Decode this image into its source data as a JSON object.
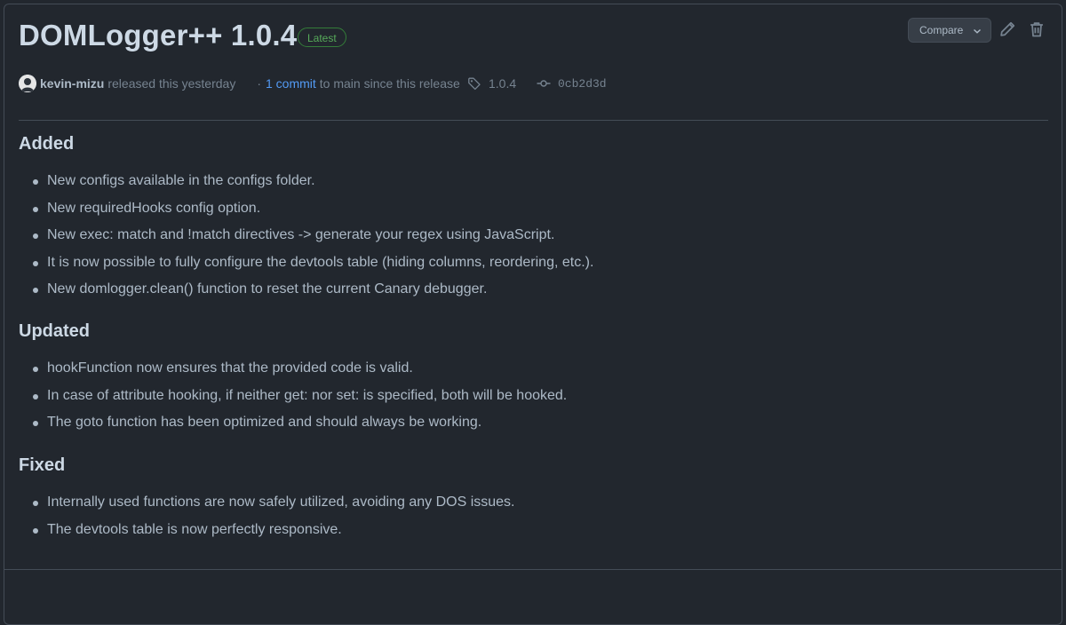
{
  "release": {
    "title": "DOMLogger++ 1.0.4",
    "badge": "Latest",
    "compare_label": "Compare",
    "author": "kevin-mizu",
    "released_text": "released this yesterday",
    "sep": "·",
    "commit_link": "1 commit",
    "commit_suffix": "to main since this release",
    "tag": "1.0.4",
    "sha": "0cb2d3d"
  },
  "icons": {
    "edit": "pencil-icon",
    "delete": "trash-icon",
    "tag": "tag-icon",
    "commit": "commit-icon",
    "caret": "chevron-down-icon"
  },
  "notes": {
    "added": {
      "heading": "Added",
      "items": [
        "New configs available in the configs folder.",
        "New requiredHooks config option.",
        "New exec: match and !match directives -> generate your regex using JavaScript.",
        "It is now possible to fully configure the devtools table (hiding columns, reordering, etc.).",
        "New domlogger.clean() function to reset the current Canary debugger."
      ]
    },
    "updated": {
      "heading": "Updated",
      "items": [
        "hookFunction now ensures that the provided code is valid.",
        "In case of attribute hooking, if neither get: nor set: is specified, both will be hooked.",
        "The goto function has been optimized and should always be working."
      ]
    },
    "fixed": {
      "heading": "Fixed",
      "items": [
        "Internally used functions are now safely utilized, avoiding any DOS issues.",
        "The devtools table is now perfectly responsive."
      ]
    }
  },
  "colors": {
    "background": "#22272e",
    "accent_link": "#539bf5",
    "latest_badge": "#57ab5a"
  }
}
